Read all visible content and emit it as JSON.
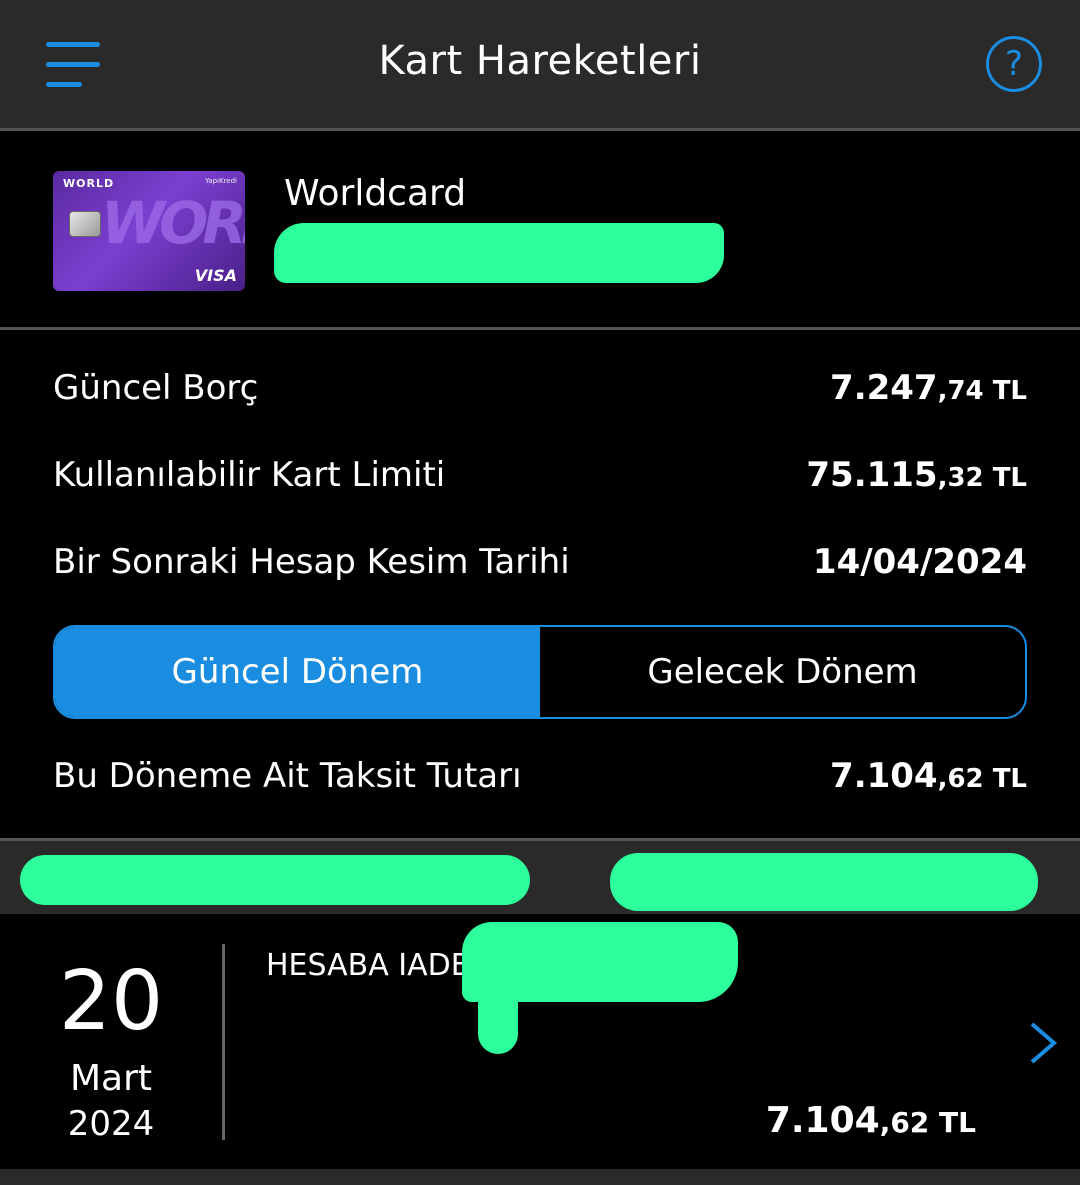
{
  "header": {
    "title": "Kart Hareketleri",
    "help_label": "?"
  },
  "card": {
    "name": "Worldcard",
    "image_brand": "WORLD",
    "image_bank": "YapıKredi",
    "image_world": "WORLD",
    "image_network": "VISA"
  },
  "summary": {
    "current_debt": {
      "label": "Güncel Borç",
      "whole": "7.247",
      "cents": ",74",
      "currency": " TL"
    },
    "available_limit": {
      "label": "Kullanılabilir Kart Limiti",
      "whole": "75.115",
      "cents": ",32",
      "currency": " TL"
    },
    "next_statement": {
      "label": "Bir Sonraki Hesap Kesim Tarihi",
      "value": "14/04/2024"
    }
  },
  "tabs": {
    "current": "Güncel Dönem",
    "future": "Gelecek Dönem"
  },
  "installment": {
    "label": "Bu Döneme Ait Taksit Tutarı",
    "whole": "7.104",
    "cents": ",62",
    "currency": " TL"
  },
  "transaction": {
    "day": "20",
    "month": "Mart",
    "year": "2024",
    "description": "HESABA IADE",
    "whole": "7.104",
    "cents": ",62",
    "currency": " TL"
  },
  "colors": {
    "accent": "#1a8de0",
    "background": "#000000",
    "header_bg": "#2a2a2a",
    "redaction": "#2cff9b"
  }
}
